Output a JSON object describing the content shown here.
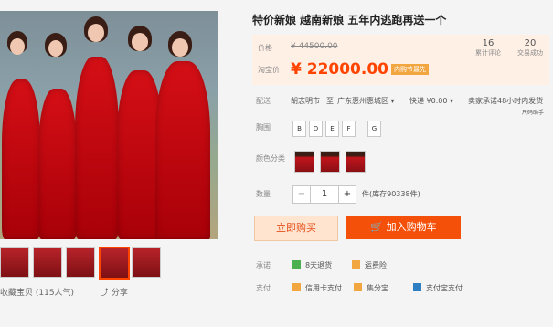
{
  "product": {
    "title": "特价新娘  越南新娘  五年内逃跑再送一个"
  },
  "price": {
    "label": "价格",
    "old_value": "¥ 44500.00",
    "taobao_label": "淘宝价",
    "new_value": "¥ 22000.00",
    "promo_tag": "内购节最先"
  },
  "stats": [
    {
      "number": "16",
      "text": "累计评论"
    },
    {
      "number": "20",
      "text": "交易成功"
    }
  ],
  "shipping": {
    "label": "配送",
    "from": "胡志明市",
    "to_word": "至",
    "to": "广东惠州惠城区",
    "courier": "快递",
    "fee": "¥0.00",
    "note": "卖家承诺48小时内发货",
    "note2": "尺码助手"
  },
  "size": {
    "label": "胸围",
    "options": [
      "B",
      "D",
      "E",
      "F",
      "G"
    ]
  },
  "color": {
    "label": "颜色分类"
  },
  "quantity": {
    "label": "数量",
    "value": "1",
    "minus": "−",
    "plus": "+",
    "stock": "件(库存90338件)"
  },
  "buttons": {
    "buy": "立即购买",
    "cart": "加入购物车"
  },
  "promise": {
    "label": "承诺",
    "return": "8天退货",
    "insurance": "运费险"
  },
  "payment": {
    "label": "支付",
    "credit": "信用卡支付",
    "jifenbao": "集分宝",
    "alipay": "支付宝支付"
  },
  "left": {
    "favorite": "收藏宝贝 (115人气)",
    "share": "分享"
  },
  "colors": {
    "accent": "#f5500a",
    "price": "#ff4400",
    "dress": "#c8101a"
  }
}
